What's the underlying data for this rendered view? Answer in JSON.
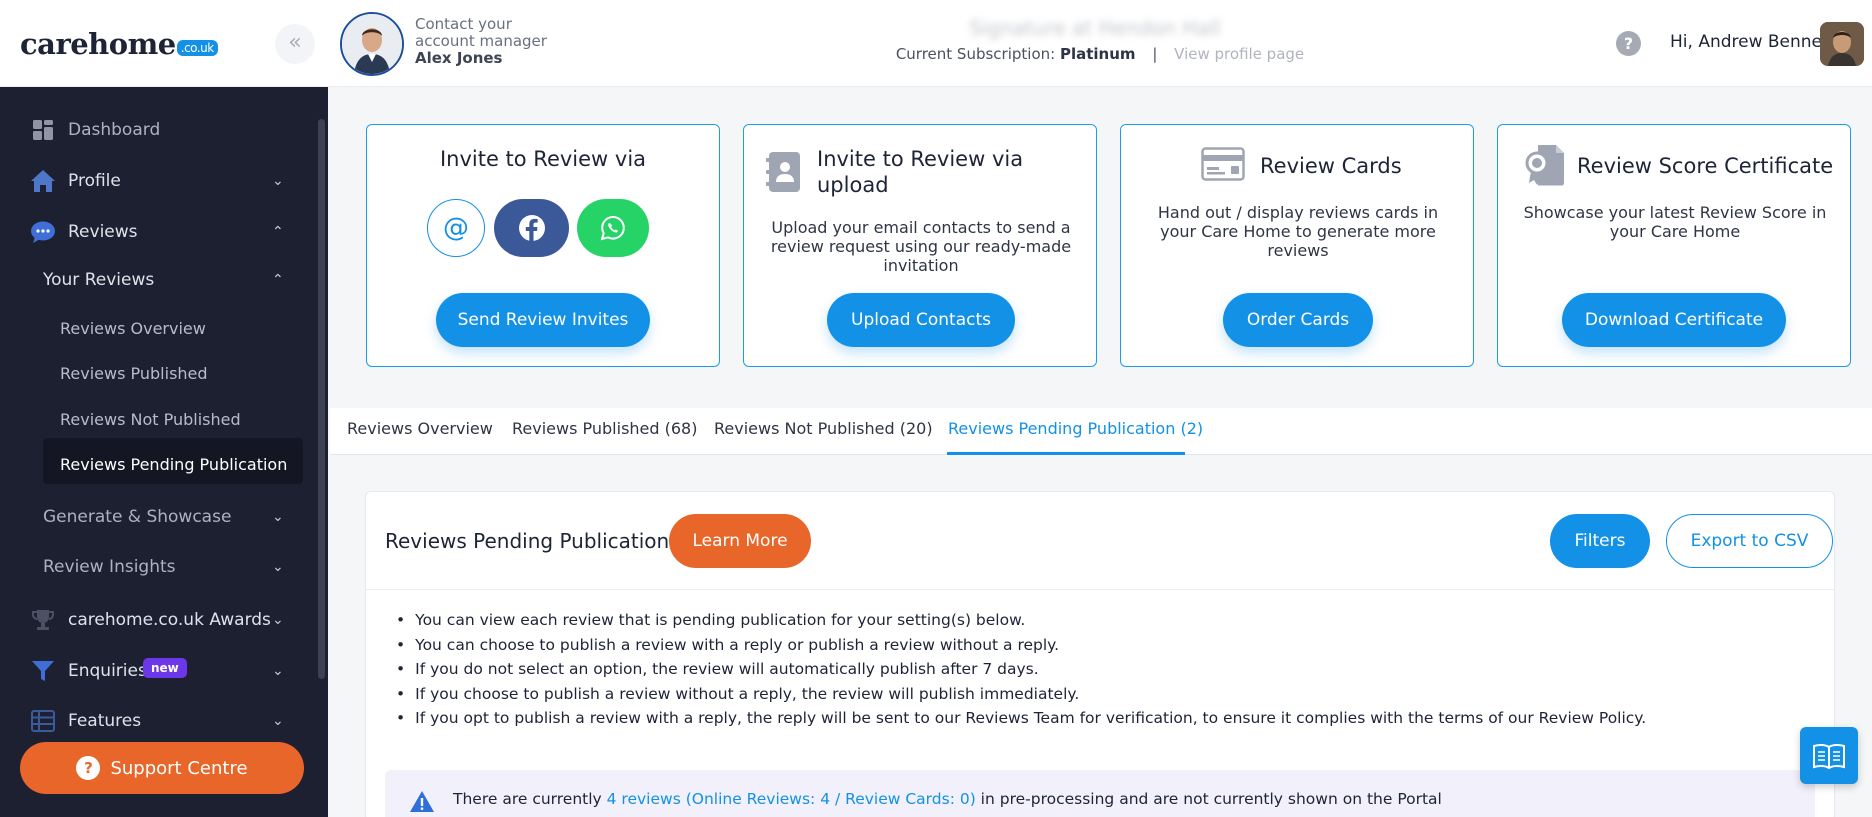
{
  "brand": {
    "name": "carehome",
    "tld": ".co.uk"
  },
  "header": {
    "collapse_glyph": "«",
    "manager_line1": "Contact your",
    "manager_line2": "account manager",
    "manager_name": "Alex Jones",
    "home_name": "Signature at Hendon Hall",
    "subscription_label": "Current Subscription:",
    "subscription_plan": "Platinum",
    "separator": "|",
    "profile_link": "View profile page",
    "help_glyph": "?",
    "greeting": "Hi, Andrew Bennett"
  },
  "sidebar": {
    "dashboard": "Dashboard",
    "profile": "Profile",
    "reviews": "Reviews",
    "your_reviews": "Your Reviews",
    "reviews_overview": "Reviews Overview",
    "reviews_published": "Reviews Published",
    "reviews_not_published": "Reviews Not Published",
    "reviews_pending": "Reviews Pending Publication",
    "generate_showcase": "Generate & Showcase",
    "review_insights": "Review Insights",
    "awards": "carehome.co.uk Awards",
    "enquiries": "Enquiries",
    "enquiries_badge": "new",
    "features": "Features",
    "support": "Support Centre",
    "support_glyph": "?"
  },
  "cards": {
    "invite": {
      "title": "Invite to Review via",
      "button": "Send Review Invites"
    },
    "upload": {
      "title_line1": "Invite to Review via",
      "title_line2": "upload",
      "desc": "Upload your email contacts to send a review request using our ready-made invitation",
      "button": "Upload Contacts"
    },
    "review_cards": {
      "title": "Review Cards",
      "desc": "Hand out / display reviews cards in your Care Home to generate more reviews",
      "button": "Order Cards"
    },
    "certificate": {
      "title": "Review Score Certificate",
      "desc": "Showcase your latest Review Score in your Care Home",
      "button": "Download Certificate"
    }
  },
  "tabs": {
    "overview": "Reviews Overview",
    "published": "Reviews Published (68)",
    "not_published": "Reviews Not Published (20)",
    "pending": "Reviews Pending Publication (2)"
  },
  "panel": {
    "title": "Reviews Pending Publication",
    "learn_more": "Learn More",
    "filters": "Filters",
    "export": "Export to CSV",
    "rules": [
      "You can view each review that is pending publication for your setting(s) below.",
      "You can choose to publish a review with a reply or publish a review without a reply.",
      "If you do not select an option, the review will automatically publish after 7 days.",
      "If you choose to publish a review without a reply, the review will publish immediately.",
      "If you opt to publish a review with a reply, the reply will be sent to our Reviews Team for verification, to ensure it complies with the terms of our Review Policy."
    ],
    "notice_prefix": "There are currently ",
    "notice_link": "4 reviews (Online Reviews: 4 / Review Cards: 0)",
    "notice_suffix": " in pre-processing and are not currently shown on the Portal"
  },
  "colors": {
    "accent": "#1391e6",
    "orange": "#e8662a",
    "sidebar_bg": "#1d2031",
    "facebook": "#3b5998",
    "whatsapp": "#25d366",
    "new_badge": "#6b37e8"
  },
  "icons": [
    "collapse-icon",
    "help-icon",
    "dashboard-icon",
    "home-icon",
    "chat-icon",
    "trophy-icon",
    "filter-icon",
    "table-icon",
    "email-icon",
    "facebook-icon",
    "whatsapp-icon",
    "contact-book-icon",
    "card-icon",
    "certificate-icon",
    "warning-icon",
    "book-icon"
  ]
}
